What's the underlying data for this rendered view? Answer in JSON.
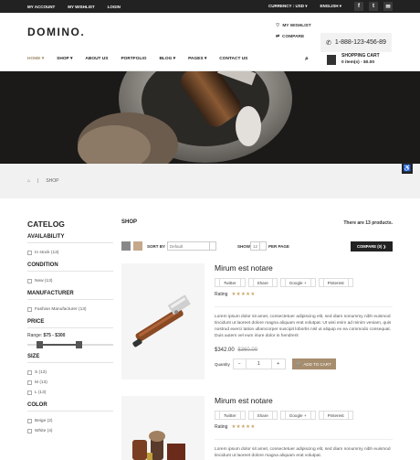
{
  "topbar": {
    "links": [
      "MY ACCOUNT",
      "MY WISHLIST",
      "LOGIN"
    ],
    "currency": "CURRENCY : USD",
    "language": "ENGLISH",
    "social": [
      {
        "icon": "facebook-icon",
        "glyph": "f"
      },
      {
        "icon": "twitter-icon",
        "glyph": "t"
      },
      {
        "icon": "email-icon",
        "glyph": "✉"
      }
    ]
  },
  "header": {
    "logo": "DOMINO.",
    "wishlist": "MY WISHLIST",
    "compare": "COMPARE",
    "phone": "1-888-123-456-89"
  },
  "nav": {
    "items": [
      "HOME",
      "SHOP",
      "ABOUT US",
      "PORTFOLIO",
      "BLOG",
      "PAGES",
      "CONTACT US"
    ],
    "active": "HOME",
    "cart_title": "SHOPPING CART",
    "cart_summary": "0 item(s) - $0.00"
  },
  "breadcrumb": {
    "home_icon": "home-icon",
    "current": "SHOP",
    "separator": "|"
  },
  "sidebar": {
    "title": "CATELOG",
    "availability": {
      "heading": "AVAILABILITY",
      "items": [
        "In stock (13)"
      ]
    },
    "condition": {
      "heading": "CONDITION",
      "items": [
        "New (13)"
      ]
    },
    "manufacturer": {
      "heading": "MANUFACTURER",
      "items": [
        "Fashion Manufacturer (13)"
      ]
    },
    "price": {
      "heading": "PRICE",
      "range_label": "Range:",
      "range_value": "$75 - $300"
    },
    "size": {
      "heading": "SIZE",
      "items": [
        "S (13)",
        "M (13)",
        "L (13)"
      ]
    },
    "color": {
      "heading": "COLOR",
      "items": [
        "Beige (2)",
        "White (4)"
      ]
    }
  },
  "main": {
    "title": "SHOP",
    "count": "There are 13 products.",
    "sort_label": "SORT BY",
    "sort_value": "Default",
    "show_label": "SHOW",
    "show_value": "12",
    "per_page": "PER PAGE",
    "compare_button": "COMPARE (0) ❯"
  },
  "products": [
    {
      "name": "Mirum est notare",
      "share": [
        "Twitter",
        "Share",
        "Google +",
        "Pinterest"
      ],
      "rating_label": "Rating",
      "stars": "★★★★★",
      "description": "Lorem ipsum dolor sit amet, consectetuer adipiscing elit, sed diam nonummy nibh euismod tincidunt ut laoreet dolore magna aliquam erat volutpat. Ut wisi enim ad minim veniam, quis nostrud exerci tation ullamcorper suscipit lobortis nisl ut aliquip ex ea commodo consequat. Duis autem vel eum iriure dolor in hendrerit",
      "price": "$342.00",
      "old_price": "$360.00",
      "qty_label": "Quantity",
      "qty_value": "1",
      "add_to_cart": "ADD TO CART"
    },
    {
      "name": "Mirum est notare",
      "share": [
        "Twitter",
        "Share",
        "Google +",
        "Pinterest"
      ],
      "rating_label": "Rating",
      "stars": "★★★★★",
      "description": "Lorem ipsum dolor sit amet, consectetuer adipiscing elit, sed diam nonummy nibh euismod tincidunt ut laoreet dolore magna aliquam erat volutpat."
    }
  ],
  "colors": {
    "accent": "#a08c6e",
    "dark": "#222222",
    "star": "#c9a96e"
  }
}
